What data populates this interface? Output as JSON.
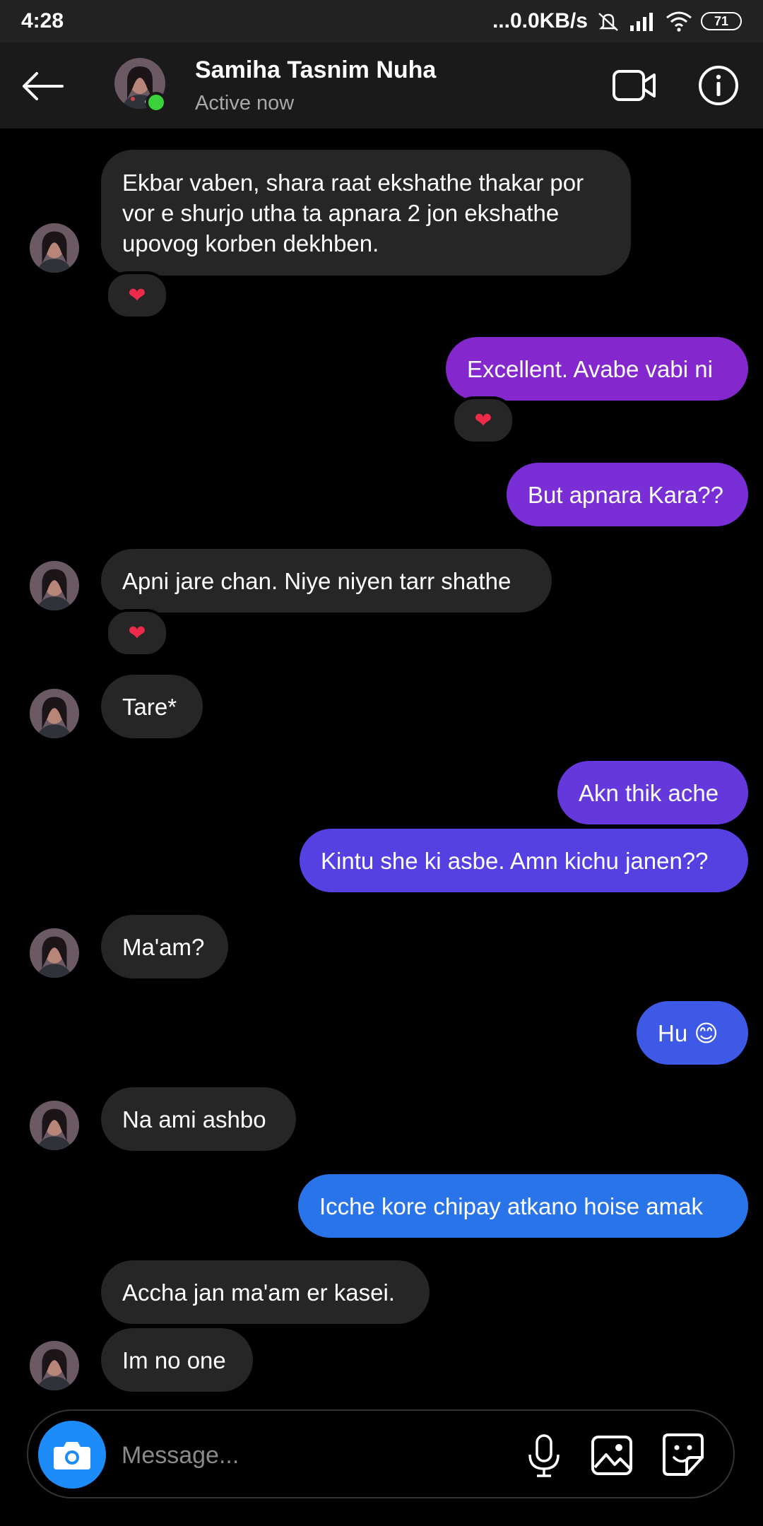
{
  "status_bar": {
    "time": "4:28",
    "network": "...0.0KB/s",
    "battery": "71"
  },
  "header": {
    "name": "Samiha Tasnim Nuha",
    "status": "Active now"
  },
  "messages": [
    {
      "from": "them",
      "text": "Ekbar vaben, shara raat ekshathe thakar por vor e shurjo utha ta apnara 2 jon ekshathe upovog korben dekhben.",
      "reaction": "❤"
    },
    {
      "from": "me",
      "text": "Excellent. Avabe vabi ni",
      "reaction": "❤"
    },
    {
      "from": "me",
      "text": "But apnara Kara??"
    },
    {
      "from": "them",
      "text": "Apni jare chan. Niye niyen tarr shathe",
      "reaction": "❤"
    },
    {
      "from": "them",
      "text": "Tare*"
    },
    {
      "from": "me",
      "text": "Akn thik ache"
    },
    {
      "from": "me",
      "text": "Kintu she ki asbe. Amn kichu janen??"
    },
    {
      "from": "them",
      "text": "Ma'am?"
    },
    {
      "from": "me",
      "text": "Hu 😊"
    },
    {
      "from": "them",
      "text": "Na ami ashbo"
    },
    {
      "from": "me",
      "text": "Icche kore chipay atkano hoise amak"
    },
    {
      "from": "them",
      "text": "Accha jan ma'am er kasei."
    },
    {
      "from": "them",
      "text": "Im no one"
    }
  ],
  "composer": {
    "placeholder": "Message..."
  },
  "colors": {
    "in_bubble": "#262626",
    "out_purple": "#8427cc",
    "out_violet": "#5a3ee0",
    "out_blue": "#2a74ea",
    "online": "#3ad13a",
    "camera": "#1d8cf8"
  }
}
